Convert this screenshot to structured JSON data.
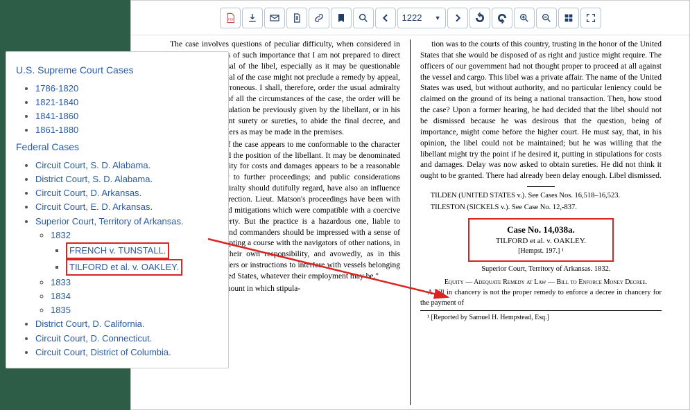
{
  "toolbar": {
    "page": "1222"
  },
  "nav": {
    "h1": "U.S. Supreme Court Cases",
    "sc": [
      "1786-1820",
      "1821-1840",
      "1841-1860",
      "1861-1880"
    ],
    "h2": "Federal Cases",
    "fc": [
      "Circuit Court, S. D. Alabama.",
      "District Court, S. D. Alabama.",
      "Circuit Court, D. Arkansas.",
      "Circuit Court, E. D. Arkansas.",
      "Superior Court, Territory of Arkansas."
    ],
    "years": [
      "1832",
      "1833",
      "1834",
      "1835"
    ],
    "cases": [
      "FRENCH v. TUNSTALL.",
      "TILFORD et al. v. OAKLEY."
    ],
    "tail": [
      "District Court, D. California.",
      "Circuit Court, D. Connecticut.",
      "Circuit Court, District of Columbia."
    ]
  },
  "doc": {
    "l1": "The case involves questions of peculiar difficulty, when considered in all its bearings, and is of such importance that I am not prepared to direct an immediate dismissal of the libel, especially as it may be questionable whether such a disposal of the case might not preclude a remedy by appeal, if such a course be erroneous. I shall, therefore, order the usual admiralty process; but in view of all the circumstances of the case, the order will be on condition that stipulation be previously given by the libellant, or in his behalf, with competent surety or sureties, to abide the final decree, and such interlocutory orders as may be made in the premises.",
    "l2": "This disposition of the case appears to me conformable to the character of the transaction, and the position of the libellant. It may be denominated a tentative suit. Security for costs and damages appears to be a reasonable requisite, preliminary to further proceedings; and public considerations which a court of admiralty should dutifully regard, have also an influence in deciding in this direction. Lieut. Matson's proceedings have been with all the alleviations and mitigations which were compatible with a coercive custody of the property. But the practice is a hazardous one, liable to hardship and abuse; and commanders should be impressed with a sense of their liabilities, in adopting a course with the navigators of other nations, in which they act on their own responsibility, and avowedly, as in this instance, \"without orders or instructions to interfere with vessels belonging to citizens of the United States, whatever their employment may be.\"",
    "l3": "In regard to the amount in which stipula-",
    "r1": "tion was to the courts of this country, trusting in the honor of the United States that she would be disposed of as right and justice might require. The officers of our government had not thought proper to proceed at all against the vessel and cargo. This libel was a private affair. The name of the United States was used, but without authority, and no particular leniency could be claimed on the ground of its being a national transaction. Then, how stood the case? Upon a former hearing, he had decided that the libel should not be dismissed because he was desirous that the question, being of importance, might come before the higher court. He must say, that, in his opinion, the libel could not be maintained; but he was willing that the libellant might try the point if he desired it, putting in stipulations for costs and damages. Delay was now asked to obtain sureties. He did not think it ought to be granted. There had already been delay enough. Libel dismissed.",
    "tilden": "TILDEN (UNITED STATES v.). See Cases Nos. 16,518–16,523.",
    "tileston": "TILESTON (SICKELS v.). See Case No. 12,-837.",
    "case_no": "Case No. 14,038a.",
    "case_title": "TILFORD et al. v. OAKLEY.",
    "case_rep": "[Hempst. 197.] ¹",
    "court": "Superior Court, Territory of Arkansas. 1832.",
    "equity": "Equity — Adequate Remedy at Law — Bill to Enforce Money Decree.",
    "bill": "A bill in chancery is not the proper remedy to enforce a decree in chancery for the payment of",
    "foot": "¹ [Reported by Samuel H. Hempstead, Esq.]"
  },
  "chart_data": null
}
